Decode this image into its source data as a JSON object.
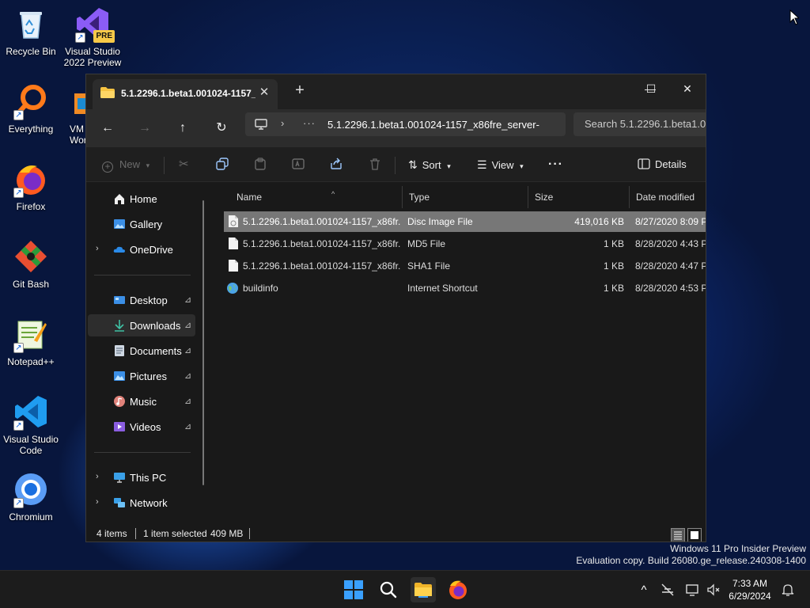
{
  "desktop": {
    "icons": [
      {
        "label": "Recycle Bin"
      },
      {
        "label": "Visual Studio 2022 Preview",
        "badge": "PRE"
      },
      {
        "label": "Everything"
      },
      {
        "label": "VM Wor"
      },
      {
        "label": "Firefox"
      },
      {
        "label": "Git Bash"
      },
      {
        "label": "Notepad++"
      },
      {
        "label": "Visual Studio Code"
      },
      {
        "label": "Chromium"
      }
    ]
  },
  "window": {
    "tab_title": "5.1.2296.1.beta1.001024-1157_x",
    "tab_close": "✕",
    "new_tab": "+",
    "minimize": "—",
    "maximize": "☐",
    "close": "✕",
    "nav": {
      "back": "←",
      "forward": "→",
      "up": "↑",
      "refresh": "↻"
    },
    "address": {
      "separator": "›",
      "ellipsis": "···",
      "path": "5.1.2296.1.beta1.001024-1157_x86fre_server-"
    },
    "search": {
      "placeholder": "Search 5.1.2296.1.beta1.0"
    },
    "toolbar": {
      "new_label": "New",
      "sort_label": "Sort",
      "view_label": "View",
      "more_label": "···",
      "details_label": "Details"
    },
    "nav_pane": {
      "home": "Home",
      "gallery": "Gallery",
      "onedrive": "OneDrive",
      "desktop": "Desktop",
      "downloads": "Downloads",
      "documents": "Documents",
      "pictures": "Pictures",
      "music": "Music",
      "videos": "Videos",
      "this_pc": "This PC",
      "network": "Network",
      "chevron": "›",
      "pin": "📌"
    },
    "columns": {
      "name": "Name",
      "type": "Type",
      "size": "Size",
      "date": "Date modified",
      "sort_caret": "^"
    },
    "files": [
      {
        "name": "5.1.2296.1.beta1.001024-1157_x86fr...",
        "type": "Disc Image File",
        "size": "419,016 KB",
        "date": "8/27/2020 8:09 P",
        "selected": true
      },
      {
        "name": "5.1.2296.1.beta1.001024-1157_x86fr...",
        "type": "MD5 File",
        "size": "1 KB",
        "date": "8/28/2020 4:43 P",
        "selected": false
      },
      {
        "name": "5.1.2296.1.beta1.001024-1157_x86fr...",
        "type": "SHA1 File",
        "size": "1 KB",
        "date": "8/28/2020 4:47 P",
        "selected": false
      },
      {
        "name": "buildinfo",
        "type": "Internet Shortcut",
        "size": "1 KB",
        "date": "8/28/2020 4:53 P",
        "selected": false
      }
    ],
    "status": {
      "items": "4 items",
      "selected": "1 item selected",
      "size": "409 MB"
    }
  },
  "watermark": {
    "line1": "Windows 11 Pro Insider Preview",
    "line2": "Evaluation copy. Build 26080.ge_release.240308-1400"
  },
  "taskbar": {
    "time": "7:33 AM",
    "date": "6/29/2024",
    "tray_chevron": "^"
  },
  "colors": {
    "accent": "#0a84ff",
    "window_bg": "#191919",
    "selected_row": "#777777",
    "folder_yellow": "#f6c342"
  }
}
